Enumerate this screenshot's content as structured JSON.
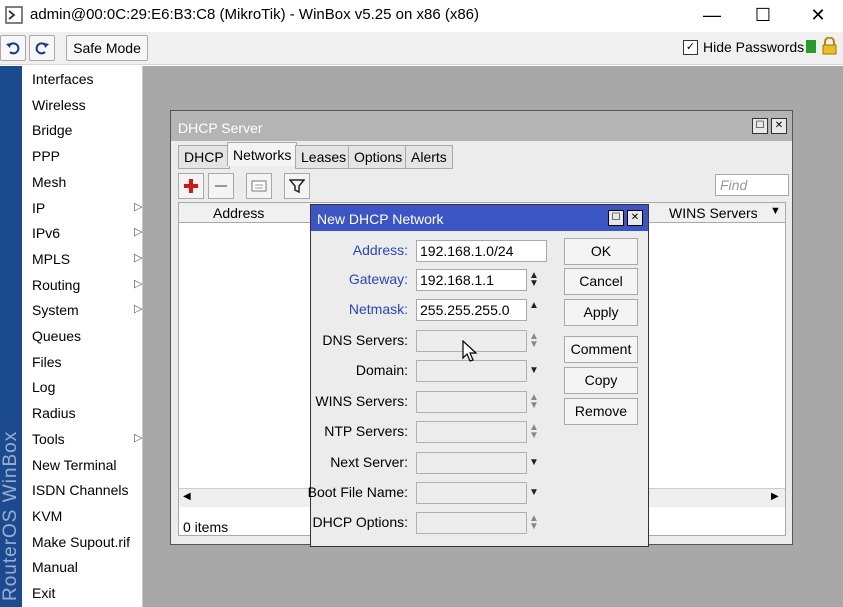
{
  "window": {
    "title": "admin@00:0C:29:E6:B3:C8 (MikroTik) - WinBox v5.25 on x86 (x86)",
    "controls": {
      "minimize": "—",
      "maximize": "☐",
      "close": "✕"
    }
  },
  "toolbar": {
    "undo_icon": "undo-icon",
    "redo_icon": "redo-icon",
    "safe_mode_label": "Safe Mode",
    "hide_passwords_label": "Hide Passwords",
    "hide_passwords_checked": true,
    "status_color": "#2a9a2a"
  },
  "sidebar": {
    "brand": "RouterOS WinBox",
    "items": [
      {
        "label": "Interfaces",
        "submenu": false
      },
      {
        "label": "Wireless",
        "submenu": false
      },
      {
        "label": "Bridge",
        "submenu": false
      },
      {
        "label": "PPP",
        "submenu": false
      },
      {
        "label": "Mesh",
        "submenu": false
      },
      {
        "label": "IP",
        "submenu": true
      },
      {
        "label": "IPv6",
        "submenu": true
      },
      {
        "label": "MPLS",
        "submenu": true
      },
      {
        "label": "Routing",
        "submenu": true
      },
      {
        "label": "System",
        "submenu": true
      },
      {
        "label": "Queues",
        "submenu": false
      },
      {
        "label": "Files",
        "submenu": false
      },
      {
        "label": "Log",
        "submenu": false
      },
      {
        "label": "Radius",
        "submenu": false
      },
      {
        "label": "Tools",
        "submenu": true
      },
      {
        "label": "New Terminal",
        "submenu": false
      },
      {
        "label": "ISDN Channels",
        "submenu": false
      },
      {
        "label": "KVM",
        "submenu": false
      },
      {
        "label": "Make Supout.rif",
        "submenu": false
      },
      {
        "label": "Manual",
        "submenu": false
      },
      {
        "label": "Exit",
        "submenu": false
      }
    ]
  },
  "dhcp_server": {
    "title": "DHCP Server",
    "tabs": [
      "DHCP",
      "Networks",
      "Leases",
      "Options",
      "Alerts"
    ],
    "active_tab": "Networks",
    "find_placeholder": "Find",
    "columns": [
      "Address",
      "WINS Servers"
    ],
    "items_count": "0 items"
  },
  "new_network_dialog": {
    "title": "New DHCP Network",
    "fields": [
      {
        "label": "Address:",
        "value": "192.168.1.0/24"
      },
      {
        "label": "Gateway:",
        "value": "192.168.1.1"
      },
      {
        "label": "Netmask:",
        "value": "255.255.255.0"
      },
      {
        "label": "DNS Servers:",
        "value": ""
      },
      {
        "label": "Domain:",
        "value": ""
      },
      {
        "label": "WINS Servers:",
        "value": ""
      },
      {
        "label": "NTP Servers:",
        "value": ""
      },
      {
        "label": "Next Server:",
        "value": ""
      },
      {
        "label": "Boot File Name:",
        "value": ""
      },
      {
        "label": "DHCP Options:",
        "value": ""
      }
    ],
    "buttons": [
      "OK",
      "Cancel",
      "Apply",
      "Comment",
      "Copy",
      "Remove"
    ]
  }
}
